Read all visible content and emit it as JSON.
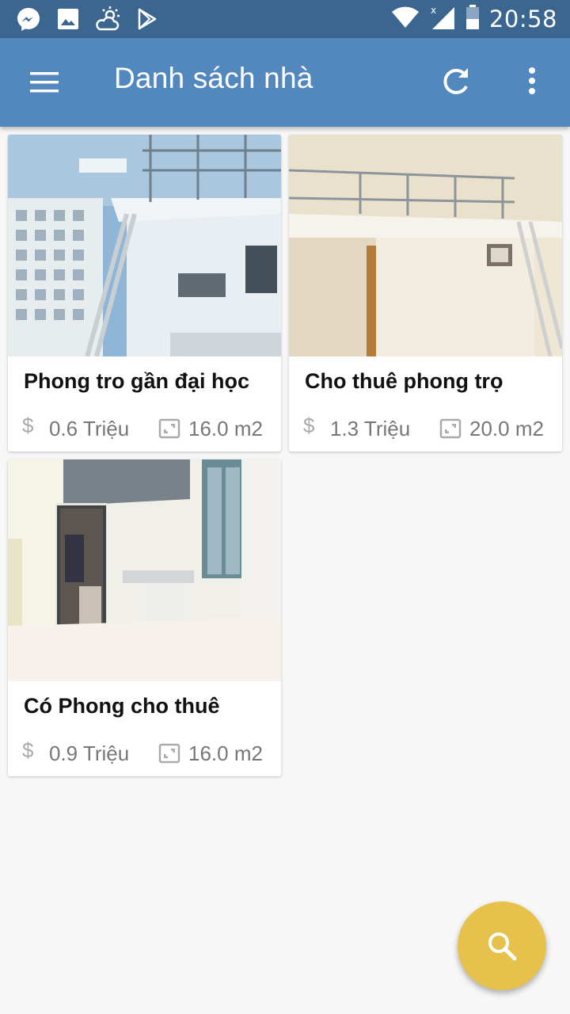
{
  "status_bar": {
    "time": "20:58",
    "icons": [
      "messenger-icon",
      "image-icon",
      "weather-icon",
      "play-store-icon",
      "wifi-icon",
      "signal-icon",
      "battery-icon"
    ]
  },
  "app_bar": {
    "title": "Danh sách nhà",
    "icons": [
      "menu-icon",
      "refresh-icon",
      "more-vert-icon"
    ],
    "color": "#5288bd"
  },
  "listings": [
    {
      "name": "Phong tro gần đại học",
      "price": "0.6 Triệu",
      "area": "16.0 m2",
      "price_icon": "$"
    },
    {
      "name": "Cho thuê phong trọ",
      "price": "1.3 Triệu",
      "area": "20.0 m2",
      "price_icon": "$"
    },
    {
      "name": "Có Phong cho thuê",
      "price": "0.9 Triệu",
      "area": "16.0 m2",
      "price_icon": "$"
    }
  ],
  "fab": {
    "icon": "search-icon",
    "color": "#e6c24c"
  }
}
